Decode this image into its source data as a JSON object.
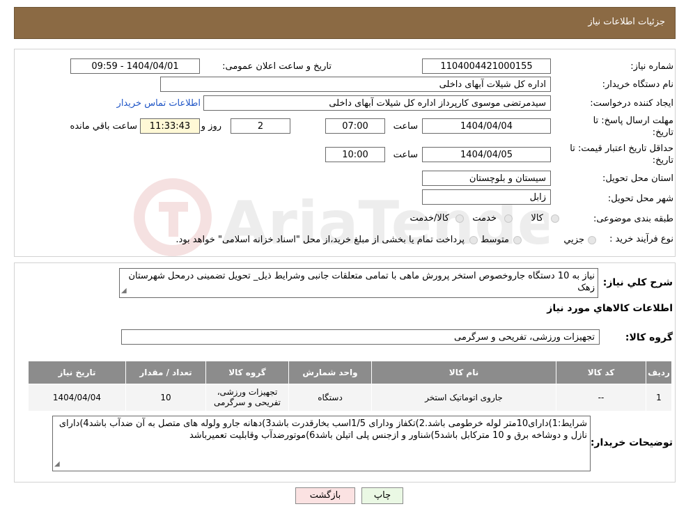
{
  "header": {
    "title": "جزئیات اطلاعات نیاز"
  },
  "info": {
    "need_number_label": "شماره نیاز:",
    "need_number": "1104004421000155",
    "announce_label": "تاریخ و ساعت اعلان عمومی:",
    "announce_value": "1404/04/01 - 09:59",
    "buyer_org_label": "نام دستگاه خریدار:",
    "buyer_org": "اداره کل شیلات آبهای داخلی",
    "creator_label": "ایجاد کننده درخواست:",
    "creator": "سیدمرتضی موسوی کارپرداز اداره کل شیلات آبهای داخلی",
    "contact_link": "اطلاعات تماس خریدار",
    "deadline_label_1": "مهلت ارسال پاسخ: تا",
    "deadline_label_2": "تاریخ:",
    "deadline_date": "1404/04/04",
    "time_word": "ساعت",
    "deadline_time": "07:00",
    "days_value": "2",
    "days_word": "روز و",
    "remaining_time": "11:33:43",
    "remaining_word": "ساعت باقي مانده",
    "validity_label_1": "حداقل تاریخ اعتبار قیمت: تا",
    "validity_label_2": "تاریخ:",
    "validity_date": "1404/04/05",
    "validity_time": "10:00",
    "province_label": "استان محل تحویل:",
    "province": "سیستان و بلوچستان",
    "city_label": "شهر محل تحویل:",
    "city": "زابل",
    "category_label": "طبقه بندی موضوعی:",
    "category_options": [
      "کالا",
      "خدمت",
      "کالا/خدمت"
    ],
    "process_label": "نوع فرآیند خرید :",
    "process_options": [
      "جزیي",
      "متوسط"
    ],
    "process_note": "پرداخت تمام یا بخشی از مبلغ خرید،از محل \"اسناد خزانه اسلامی\" خواهد بود."
  },
  "description": {
    "label": "شرح کلي نیاز:",
    "text": "نیاز به 10 دستگاه جاروخصوص استخر پرورش ماهی با تمامی متعلقات جانبی وشرایط ذیل_ تحویل تضمینی درمحل شهرستان زهک"
  },
  "goods": {
    "section_title": "اطلاعات کالاهاي مورد نیاز",
    "group_label": "گروه کالا:",
    "group_value": "تجهیزات ورزشی، تفریحی و سرگرمی"
  },
  "table": {
    "headers": [
      "ردیف",
      "کد کالا",
      "نام کالا",
      "واحد شمارش",
      "گروه کالا",
      "تعداد / مقدار",
      "تاریخ نیاز"
    ],
    "rows": [
      [
        "1",
        "--",
        "جاروی اتوماتیک استخر",
        "دستگاه",
        "تجهیزات ورزشی، تفریحی و سرگرمی",
        "10",
        "1404/04/04"
      ]
    ]
  },
  "buyer_notes": {
    "label": "توضیحات خریدار:",
    "text": "شرایط:1)دارای10متر لوله خرطومی باشد.2)تکفاز ودارای 1/5اسب بخارقدرت باشد3)دهانه جارو ولوله های متصل به آن ضدآب باشد4)دارای نازل و دوشاخه برق و 10 مترکابل باشد5)شناور و ازجنس پلی اتیلن باشد6)موتورضدآب وقابلیت تعمیرباشد"
  },
  "buttons": {
    "print": "چاپ",
    "back": "بازگشت"
  },
  "colors": {
    "header_bg": "#8b6a44",
    "table_header": "#8c8c8c",
    "time_bg": "#fff9d6",
    "print_bg": "#eaf8e4",
    "back_bg": "#fbe2e2",
    "link": "#1f55c6"
  }
}
